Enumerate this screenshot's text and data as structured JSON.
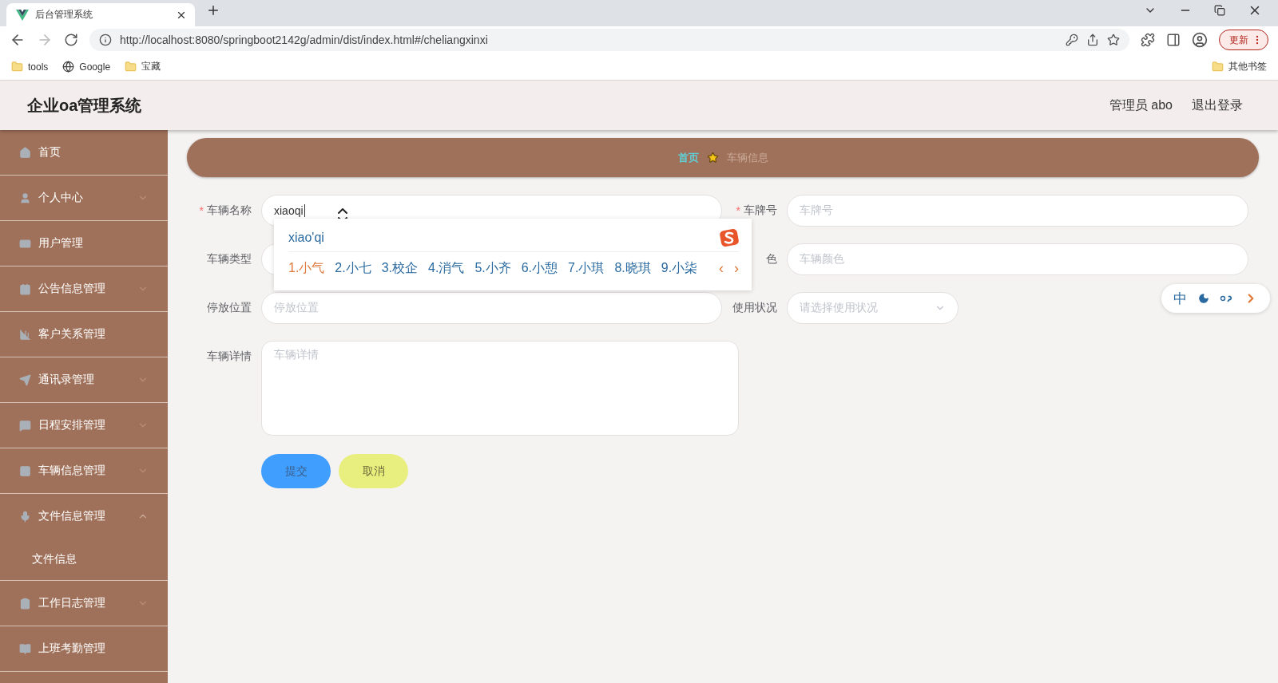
{
  "browser": {
    "tabs": [
      {
        "title": "后台管理系统",
        "selected": true
      }
    ],
    "url": "http://localhost:8080/springboot2142g/admin/dist/index.html#/cheliangxinxi",
    "update_button": "更新",
    "bookmarks": [
      {
        "label": "tools",
        "kind": "folder"
      },
      {
        "label": "Google",
        "kind": "globe"
      },
      {
        "label": "宝藏",
        "kind": "folder"
      }
    ],
    "other_bookmarks": "其他书签"
  },
  "header": {
    "title": "企业oa管理系统",
    "user": "管理员 abo",
    "logout": "退出登录"
  },
  "sidebar": {
    "items": [
      {
        "label": "首页",
        "submenu": false
      },
      {
        "label": "个人中心",
        "submenu": true,
        "expanded": false
      },
      {
        "label": "用户管理",
        "submenu": false
      },
      {
        "label": "公告信息管理",
        "submenu": true,
        "expanded": false
      },
      {
        "label": "客户关系管理",
        "submenu": false
      },
      {
        "label": "通讯录管理",
        "submenu": true,
        "expanded": false
      },
      {
        "label": "日程安排管理",
        "submenu": true,
        "expanded": false
      },
      {
        "label": "车辆信息管理",
        "submenu": true,
        "expanded": false
      },
      {
        "label": "文件信息管理",
        "submenu": true,
        "expanded": true,
        "children": [
          {
            "label": "文件信息"
          }
        ]
      },
      {
        "label": "工作日志管理",
        "submenu": true,
        "expanded": false
      },
      {
        "label": "上班考勤管理",
        "submenu": false
      }
    ]
  },
  "breadcrumb": [
    {
      "label": "首页",
      "current": false
    },
    {
      "label": "车辆信息",
      "current": true
    }
  ],
  "form": {
    "rows": [
      {
        "fields": [
          {
            "label": "车辆名称",
            "required_mark": "*",
            "kind": "input",
            "value": "xiaoqi"
          },
          {
            "label": "车牌号",
            "required_mark": "*",
            "kind": "input",
            "placeholder": "车牌号"
          }
        ]
      },
      {
        "fields": [
          {
            "label": "车辆类型",
            "kind": "input"
          },
          {
            "label": "色",
            "kind": "input",
            "placeholder": "车辆颜色"
          }
        ]
      },
      {
        "fields": [
          {
            "label": "停放位置",
            "kind": "input",
            "placeholder": "停放位置"
          },
          {
            "label": "使用状况",
            "kind": "select",
            "placeholder": "请选择使用状况"
          }
        ]
      },
      {
        "fields": [
          {
            "label": "车辆详情",
            "kind": "textarea",
            "placeholder": "车辆详情"
          }
        ]
      }
    ],
    "buttons": [
      {
        "label": "提交",
        "kind": "primary"
      },
      {
        "label": "取消",
        "kind": "cancel"
      }
    ]
  },
  "ime": {
    "composition": "xiao'qi",
    "candidates": [
      {
        "label": "1.小气",
        "selected": true
      },
      {
        "label": "2.小七",
        "selected": false
      },
      {
        "label": "3.校企",
        "selected": false
      },
      {
        "label": "4.消气",
        "selected": false
      },
      {
        "label": "5.小齐",
        "selected": false
      },
      {
        "label": "6.小憩",
        "selected": false
      },
      {
        "label": "7.小琪",
        "selected": false
      },
      {
        "label": "8.晓琪",
        "selected": false
      },
      {
        "label": "9.小柒",
        "selected": false
      }
    ],
    "prev": "‹",
    "next": "›",
    "toolbar": {
      "mode": "中"
    }
  }
}
